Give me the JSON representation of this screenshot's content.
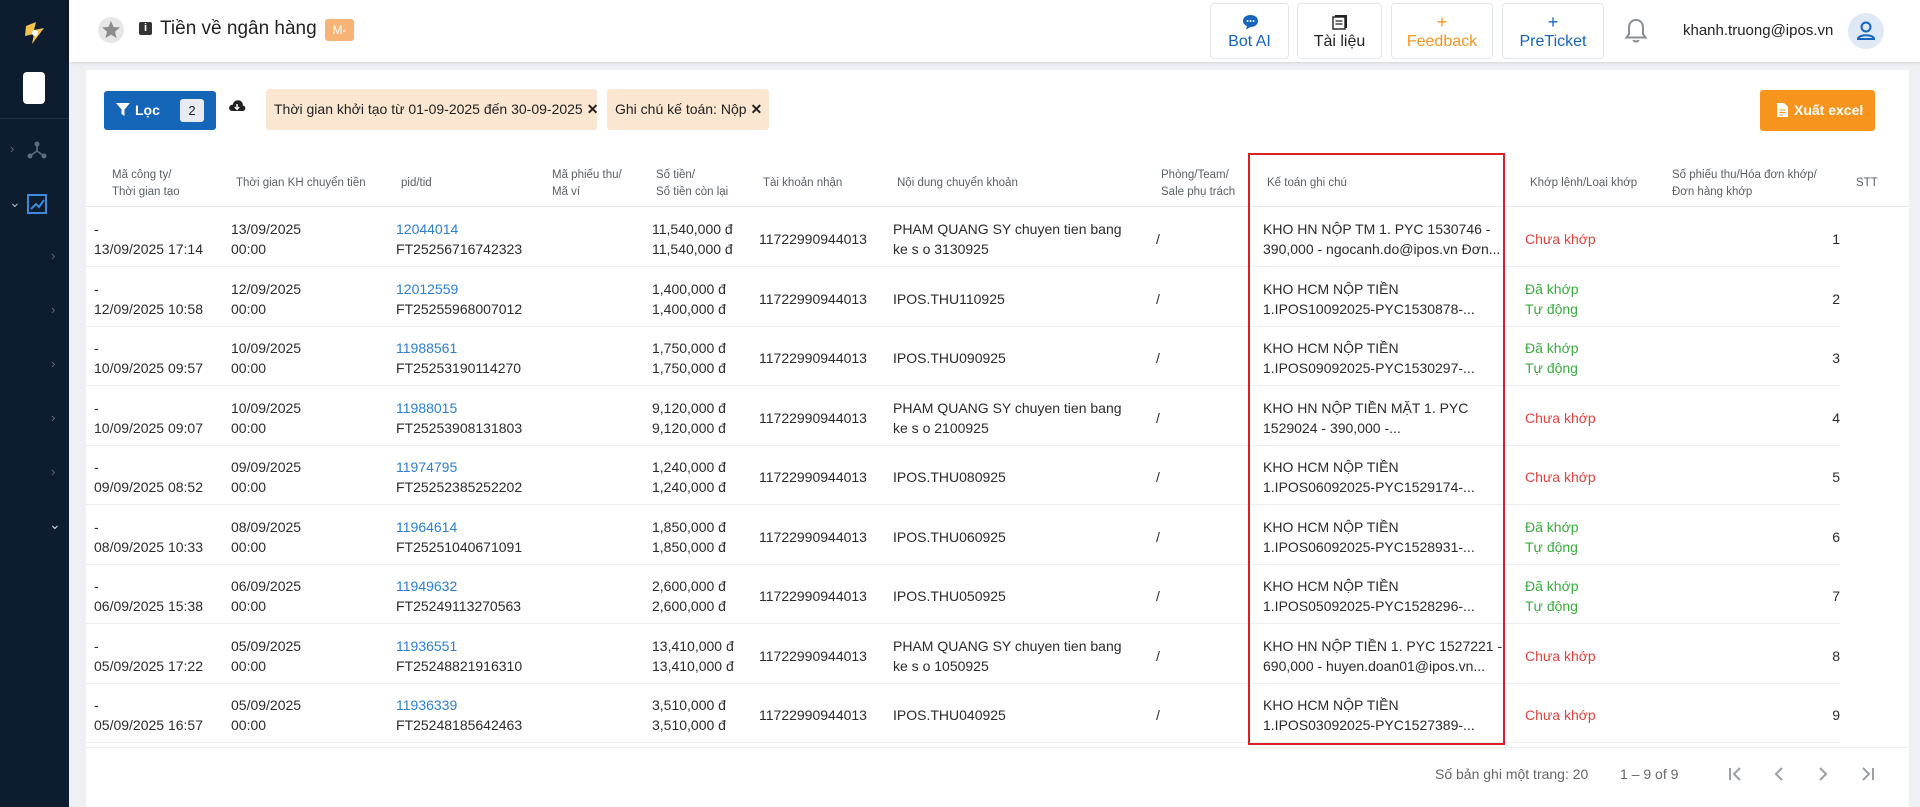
{
  "header": {
    "title": "Tiền về ngân hàng",
    "badge": "M-",
    "buttons": [
      {
        "label": "Bot AI",
        "icon": "chat-icon",
        "color": "#1565c0"
      },
      {
        "label": "Tài liệu",
        "icon": "book-icon",
        "color": "#222222"
      },
      {
        "label": "Feedback",
        "icon": "plus-icon",
        "color": "#f7941d"
      },
      {
        "label": "PreTicket",
        "icon": "plus-icon",
        "color": "#1565c0"
      }
    ],
    "user_email": "khanh.truong@ipos.vn"
  },
  "toolbar": {
    "filter_label": "Lọc",
    "filter_count": "2",
    "chips": [
      "Thời gian khởi tạo từ 01-09-2025 đến 30-09-2025",
      "Ghi chú kế toán: Nộp"
    ],
    "chip_close": "✕",
    "export_label": "Xuất excel"
  },
  "table": {
    "headers": [
      [
        "Mã công ty/",
        "Thời gian tạo"
      ],
      [
        "Thời gian KH chuyển tiền",
        ""
      ],
      [
        "pid/tid",
        ""
      ],
      [
        "Mã phiếu thu/",
        "Mã ví"
      ],
      [
        "Số tiền/",
        "Số tiền còn lại"
      ],
      [
        "Tài khoản nhận",
        ""
      ],
      [
        "Nội dung chuyển khoản",
        ""
      ],
      [
        "Phòng/Team/",
        "Sale phụ trách"
      ],
      [
        "Kế toán ghi chú",
        ""
      ],
      [
        "Khớp lệnh/Loại khớp",
        ""
      ],
      [
        "Số phiếu thu/Hóa đơn khớp/",
        "Đơn hàng khớp"
      ],
      [
        "STT",
        ""
      ]
    ],
    "rows": [
      {
        "company": "-",
        "created": "13/09/2025 17:14",
        "kh_date": "13/09/2025",
        "kh_time": "00:00",
        "pid": "12044014",
        "tid": "FT25256716742323",
        "amount": "11,540,000 đ",
        "remaining": "11,540,000 đ",
        "account": "11722990944013",
        "content1": "PHAM QUANG SY chuyen tien bang",
        "content2": "ke s o 3130925",
        "team": "/",
        "note1": "KHO HN NỘP TM 1. PYC 1530746 -",
        "note2": "390,000 - ngocanh.do@ipos.vn Đơn...",
        "status": "Chưa khớp",
        "match_type": "",
        "stt": "1"
      },
      {
        "company": "-",
        "created": "12/09/2025 10:58",
        "kh_date": "12/09/2025",
        "kh_time": "00:00",
        "pid": "12012559",
        "tid": "FT25255968007012",
        "amount": "1,400,000 đ",
        "remaining": "1,400,000 đ",
        "account": "11722990944013",
        "content1": "IPOS.THU110925",
        "content2": "",
        "team": "/",
        "note1": "KHO HCM NỘP TIỀN",
        "note2": "1.IPOS10092025-PYC1530878-...",
        "status": "Đã khớp",
        "match_type": "Tự động",
        "stt": "2"
      },
      {
        "company": "-",
        "created": "10/09/2025 09:57",
        "kh_date": "10/09/2025",
        "kh_time": "00:00",
        "pid": "11988561",
        "tid": "FT25253190114270",
        "amount": "1,750,000 đ",
        "remaining": "1,750,000 đ",
        "account": "11722990944013",
        "content1": "IPOS.THU090925",
        "content2": "",
        "team": "/",
        "note1": "KHO HCM NỘP TIỀN",
        "note2": "1.IPOS09092025-PYC1530297-...",
        "status": "Đã khớp",
        "match_type": "Tự động",
        "stt": "3"
      },
      {
        "company": "-",
        "created": "10/09/2025 09:07",
        "kh_date": "10/09/2025",
        "kh_time": "00:00",
        "pid": "11988015",
        "tid": "FT25253908131803",
        "amount": "9,120,000 đ",
        "remaining": "9,120,000 đ",
        "account": "11722990944013",
        "content1": "PHAM QUANG SY chuyen tien bang",
        "content2": "ke s o 2100925",
        "team": "/",
        "note1": "KHO HN NỘP TIỀN MẶT 1. PYC",
        "note2": "1529024 - 390,000 -...",
        "status": "Chưa khớp",
        "match_type": "",
        "stt": "4"
      },
      {
        "company": "-",
        "created": "09/09/2025 08:52",
        "kh_date": "09/09/2025",
        "kh_time": "00:00",
        "pid": "11974795",
        "tid": "FT25252385252202",
        "amount": "1,240,000 đ",
        "remaining": "1,240,000 đ",
        "account": "11722990944013",
        "content1": "IPOS.THU080925",
        "content2": "",
        "team": "/",
        "note1": "KHO HCM NỘP TIỀN",
        "note2": "1.IPOS06092025-PYC1529174-...",
        "status": "Chưa khớp",
        "match_type": "",
        "stt": "5"
      },
      {
        "company": "-",
        "created": "08/09/2025 10:33",
        "kh_date": "08/09/2025",
        "kh_time": "00:00",
        "pid": "11964614",
        "tid": "FT25251040671091",
        "amount": "1,850,000 đ",
        "remaining": "1,850,000 đ",
        "account": "11722990944013",
        "content1": "IPOS.THU060925",
        "content2": "",
        "team": "/",
        "note1": "KHO HCM NỘP TIỀN",
        "note2": "1.IPOS06092025-PYC1528931-...",
        "status": "Đã khớp",
        "match_type": "Tự động",
        "stt": "6"
      },
      {
        "company": "-",
        "created": "06/09/2025 15:38",
        "kh_date": "06/09/2025",
        "kh_time": "00:00",
        "pid": "11949632",
        "tid": "FT25249113270563",
        "amount": "2,600,000 đ",
        "remaining": "2,600,000 đ",
        "account": "11722990944013",
        "content1": "IPOS.THU050925",
        "content2": "",
        "team": "/",
        "note1": "KHO HCM NỘP TIỀN",
        "note2": "1.IPOS05092025-PYC1528296-...",
        "status": "Đã khớp",
        "match_type": "Tự động",
        "stt": "7"
      },
      {
        "company": "-",
        "created": "05/09/2025 17:22",
        "kh_date": "05/09/2025",
        "kh_time": "00:00",
        "pid": "11936551",
        "tid": "FT25248821916310",
        "amount": "13,410,000 đ",
        "remaining": "13,410,000 đ",
        "account": "11722990944013",
        "content1": "PHAM QUANG SY chuyen tien bang",
        "content2": "ke s o 1050925",
        "team": "/",
        "note1": "KHO HN NỘP TIỀN 1. PYC 1527221 -",
        "note2": "690,000 - huyen.doan01@ipos.vn...",
        "status": "Chưa khớp",
        "match_type": "",
        "stt": "8"
      },
      {
        "company": "-",
        "created": "05/09/2025 16:57",
        "kh_date": "05/09/2025",
        "kh_time": "00:00",
        "pid": "11936339",
        "tid": "FT25248185642463",
        "amount": "3,510,000 đ",
        "remaining": "3,510,000 đ",
        "account": "11722990944013",
        "content1": "IPOS.THU040925",
        "content2": "",
        "team": "/",
        "note1": "KHO HCM NỘP TIỀN",
        "note2": "1.IPOS03092025-PYC1527389-...",
        "status": "Chưa khớp",
        "match_type": "",
        "stt": "9"
      }
    ]
  },
  "pagination": {
    "page_size_label": "Số bản ghi một trang:",
    "page_size": "20",
    "range": "1 – 9 of 9"
  },
  "colors": {
    "primary": "#1565b9",
    "accent": "#f7941d",
    "unmatched": "#e0443e",
    "matched": "#3aac3f",
    "link": "#2c7fd1",
    "highlight": "#d92027"
  }
}
